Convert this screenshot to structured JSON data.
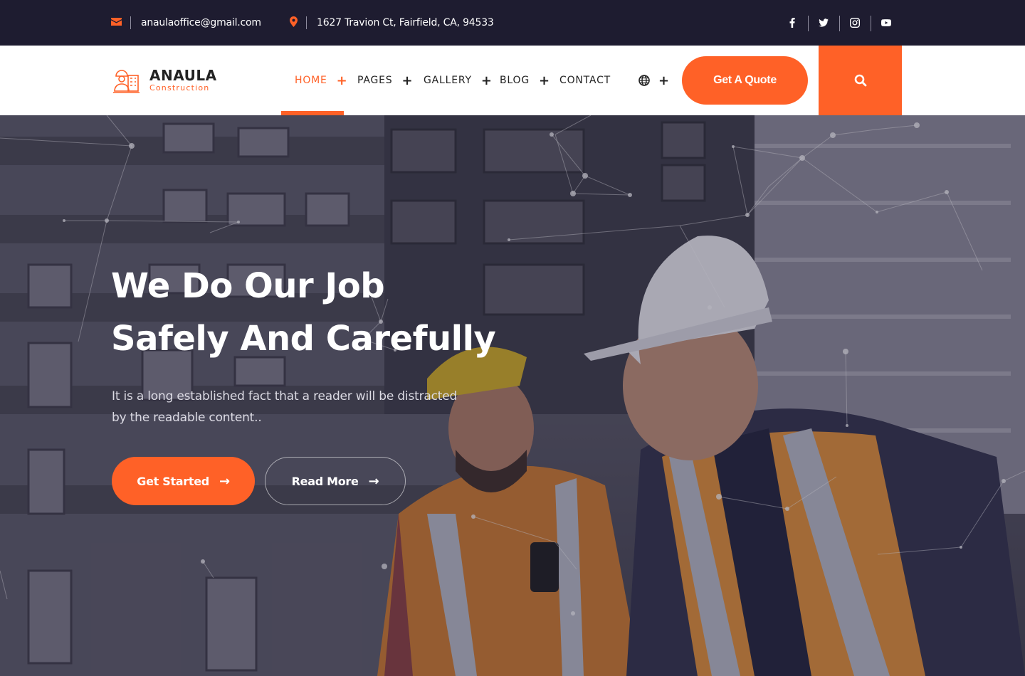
{
  "topbar": {
    "email": "anaulaoffice@gmail.com",
    "address": "1627 Travion Ct, Fairfield, CA, 94533",
    "social": [
      "facebook-icon",
      "twitter-icon",
      "instagram-icon",
      "youtube-icon"
    ]
  },
  "header": {
    "brand": "ANAULA",
    "brand_sub": "Construction",
    "nav": [
      {
        "label": "HOME",
        "has_submenu": true,
        "active": true
      },
      {
        "label": "PAGES",
        "has_submenu": true
      },
      {
        "label": "GALLERY",
        "has_submenu": true
      },
      {
        "label": "BLOG",
        "has_submenu": true
      },
      {
        "label": "CONTACT",
        "has_submenu": false
      }
    ],
    "quote_label": "Get A Quote"
  },
  "hero": {
    "title_line1": "We Do Our Job",
    "title_line2": "Safely And Carefully",
    "desc_line1": "It is a long established fact that a reader will be distracted",
    "desc_line2": "by the readable content..",
    "primary_label": "Get Started",
    "secondary_label": "Read More"
  },
  "colors": {
    "accent": "#ff6127",
    "topbar_bg": "#1e1c30",
    "vest": "#f39a2a",
    "helmet_yellow": "#f2c31a"
  }
}
